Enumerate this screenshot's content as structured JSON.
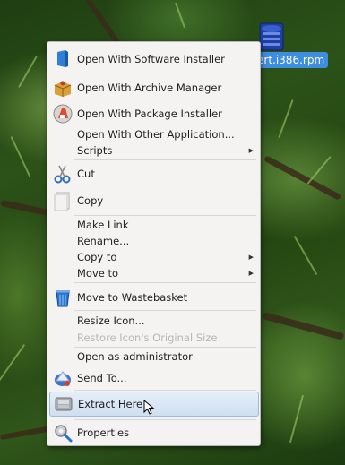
{
  "desktop": {
    "file_name": "ert.i386.rpm"
  },
  "menu": {
    "items": [
      {
        "label": "Open With Software Installer",
        "icon": "software-installer-icon"
      },
      {
        "label": "Open With Archive Manager",
        "icon": "archive-manager-icon"
      },
      {
        "label": "Open With Package Installer",
        "icon": "package-installer-icon"
      },
      {
        "label": "Open With Other Application...",
        "icon": ""
      },
      {
        "label": "Scripts",
        "icon": "",
        "submenu": true
      },
      {
        "label": "Cut",
        "icon": "scissors-icon"
      },
      {
        "label": "Copy",
        "icon": "copy-icon"
      },
      {
        "label": "Make Link",
        "icon": ""
      },
      {
        "label": "Rename...",
        "icon": ""
      },
      {
        "label": "Copy to",
        "icon": "",
        "submenu": true
      },
      {
        "label": "Move to",
        "icon": "",
        "submenu": true
      },
      {
        "label": "Move to Wastebasket",
        "icon": "trash-icon"
      },
      {
        "label": "Resize Icon...",
        "icon": ""
      },
      {
        "label": "Restore Icon's Original Size",
        "icon": "",
        "disabled": true
      },
      {
        "label": "Open as administrator",
        "icon": ""
      },
      {
        "label": "Send To...",
        "icon": "send-to-icon"
      },
      {
        "label": "Extract Here",
        "icon": "extract-icon",
        "highlighted": true
      },
      {
        "label": "Properties",
        "icon": "properties-icon"
      }
    ]
  }
}
